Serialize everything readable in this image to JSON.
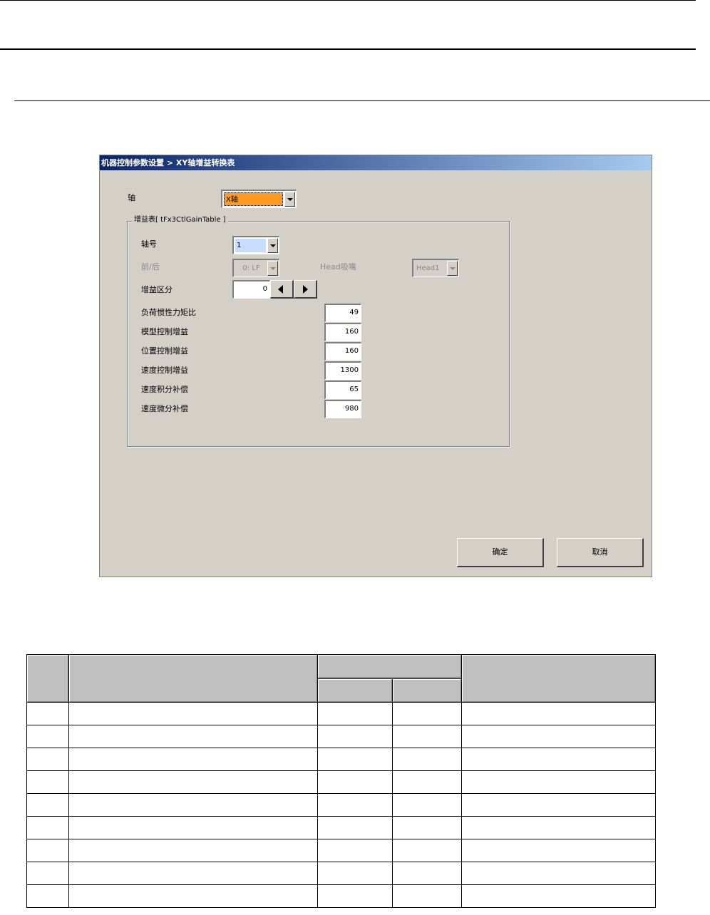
{
  "dialog": {
    "title": "机器控制参数设置 > XY轴增益转换表",
    "axis_label": "轴",
    "axis_value": "X轴",
    "group_title": "增益表[ tFx3CtlGainTable ]",
    "axis_no_label": "轴号",
    "axis_no_value": "1",
    "front_rear_label": "前/后",
    "front_rear_value": "0: LF",
    "head_nozzle_label": "Head吸嘴",
    "head_value": "Head1",
    "gain_div_label": "增益区分",
    "gain_div_value": "0",
    "params": [
      {
        "label": "负荷惯性力矩比",
        "value": "49"
      },
      {
        "label": "模型控制增益",
        "value": "160"
      },
      {
        "label": "位置控制增益",
        "value": "160"
      },
      {
        "label": "速度控制增益",
        "value": "1300"
      },
      {
        "label": "速度积分补偿",
        "value": "65"
      },
      {
        "label": "速度微分补偿",
        "value": "980"
      }
    ],
    "ok_label": "确定",
    "cancel_label": "取消"
  },
  "colors": {
    "title_start": "#0a246a",
    "title_end": "#a6caf0",
    "axis_combo_bg": "#ff9a1f",
    "axis_no_combo_bg": "#c6ddff",
    "dialog_bg": "#d4d0c8",
    "table_header_bg": "#c0c0c0"
  }
}
